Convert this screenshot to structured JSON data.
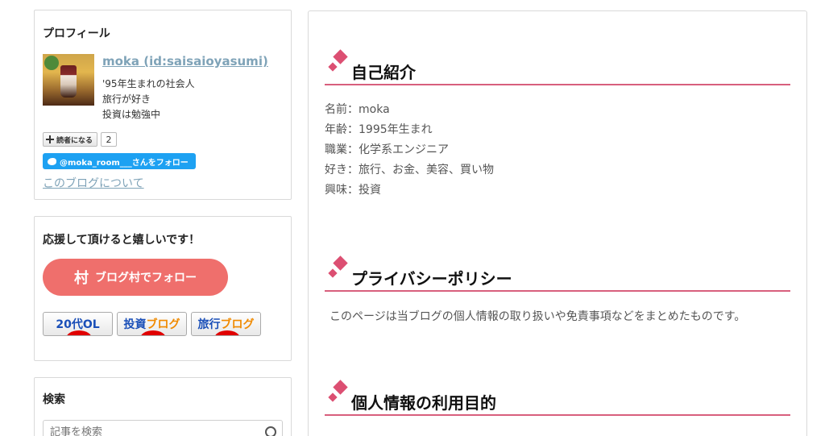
{
  "sidebar": {
    "profile": {
      "title": "プロフィール",
      "name": "moka (id:saisaioyasumi)",
      "desc": [
        "'95年生まれの社会人",
        "旅行が好き",
        "投資は勉強中"
      ],
      "subscribe_label": "読者になる",
      "subscribe_count": "2",
      "twitter_label": "@moka_room___さんをフォロー",
      "about_link": "このブログについて"
    },
    "support": {
      "title": "応援して頂けると嬉しいです！",
      "village_icon": "村",
      "village_label": "ブログ村でフォロー",
      "banners": [
        {
          "blue": "20代OL",
          "orange": ""
        },
        {
          "blue": "投資",
          "orange": "ブログ"
        },
        {
          "blue": "旅行",
          "orange": "ブログ"
        }
      ]
    },
    "search": {
      "title": "検索",
      "placeholder": "記事を検索"
    }
  },
  "main": {
    "sections": [
      {
        "title": "自己紹介"
      },
      {
        "title": "プライバシーポリシー"
      },
      {
        "title": "個人情報の利用目的"
      }
    ],
    "intro": [
      "名前：moka",
      "年齢：1995年生まれ",
      "職業：化学系エンジニア",
      "好き：旅行、お金、美容、買い物",
      "興味：投資"
    ],
    "privacy_text": "このページは当ブログの個人情報の取り扱いや免責事項などをまとめたものです。"
  },
  "colors": {
    "accent": "#dc4f72",
    "link": "#7fa3b8",
    "twitter": "#1da1f2",
    "village": "#ef6f6c"
  }
}
